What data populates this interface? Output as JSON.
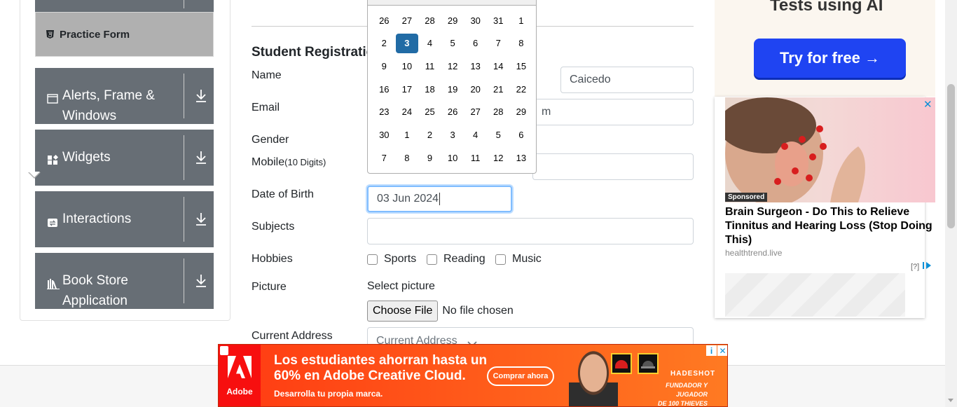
{
  "sidebar": {
    "practice_item": "Practice Form",
    "groups": [
      {
        "label_line1": "Alerts, Frame &",
        "label_line2": "Windows",
        "icon": "window-icon"
      },
      {
        "label_line1": "Widgets",
        "label_line2": "",
        "icon": "widgets-icon"
      },
      {
        "label_line1": "Interactions",
        "label_line2": "",
        "icon": "interactions-icon"
      },
      {
        "label_line1": "Book Store",
        "label_line2": "Application",
        "icon": "books-icon"
      }
    ]
  },
  "form": {
    "title": "Student Registratio",
    "labels": {
      "name": "Name",
      "email": "Email",
      "gender": "Gender",
      "mobile": "Mobile",
      "mobile_hint": "(10 Digits)",
      "dob": "Date of Birth",
      "subjects": "Subjects",
      "hobbies": "Hobbies",
      "picture": "Picture",
      "address": "Current Address"
    },
    "last_name_value": "Caicedo",
    "email_value_tail": "m",
    "dob_value": "03 Jun 2024",
    "hobbies": [
      "Sports",
      "Reading",
      "Music"
    ],
    "select_picture": "Select picture",
    "choose_file": "Choose File",
    "no_file": "No file chosen",
    "address_placeholder": "Current Address"
  },
  "datepicker": {
    "weeks": [
      [
        "26",
        "27",
        "28",
        "29",
        "30",
        "31",
        "1"
      ],
      [
        "2",
        "3",
        "4",
        "5",
        "6",
        "7",
        "8"
      ],
      [
        "9",
        "10",
        "11",
        "12",
        "13",
        "14",
        "15"
      ],
      [
        "16",
        "17",
        "18",
        "19",
        "20",
        "21",
        "22"
      ],
      [
        "23",
        "24",
        "25",
        "26",
        "27",
        "28",
        "29"
      ],
      [
        "30",
        "1",
        "2",
        "3",
        "4",
        "5",
        "6"
      ],
      [
        "7",
        "8",
        "9",
        "10",
        "11",
        "12",
        "13"
      ]
    ],
    "selected": "3"
  },
  "ads": {
    "top_title": "Tests using AI",
    "try_button": "Try for free →",
    "sponsored": "Sponsored",
    "headline": "Brain Surgeon - Do This to Relieve Tinnitus and Hearing Loss (Stop Doing This)",
    "source": "healthtrend.live",
    "info": "[?]",
    "close": "✕"
  },
  "bottom_ad": {
    "logo_text": "Adobe",
    "headline_line1": "Los estudiantes ahorran hasta un",
    "headline_line2": "60% en Adobe Creative Cloud.",
    "sub": "Desarrolla tu propia marca.",
    "button": "Comprar ahora",
    "brand": "HADESHOT",
    "role_line1": "FUNDADOR Y JUGADOR",
    "role_line2": "DE 100 THIEVES"
  },
  "colors": {
    "sidebar_bg": "#676e75",
    "accent_selected": "#216ba5",
    "try_button": "#1f44f2",
    "adobe_red": "#ff3a12"
  }
}
